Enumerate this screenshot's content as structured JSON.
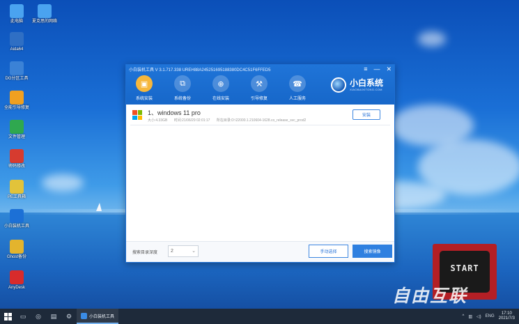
{
  "desktop": {
    "icons": [
      {
        "label": "此电脑",
        "icon": "computer-icon",
        "color": "#4aa3f0"
      },
      {
        "label": "夏克思的网络",
        "icon": "network-icon",
        "color": "#4aa3f0"
      },
      {
        "label": "Aida64",
        "icon": "aida64-icon",
        "color": "#2f6fc4"
      },
      {
        "label": "DG分区工具",
        "icon": "partition-icon",
        "color": "#3b82d6"
      },
      {
        "label": "全能引导修复",
        "icon": "repair-icon",
        "color": "#f0a020"
      },
      {
        "label": "文件管理",
        "icon": "file-manager-icon",
        "color": "#2fa84f"
      },
      {
        "label": "密码修改",
        "icon": "password-icon",
        "color": "#d63b2f"
      },
      {
        "label": "PE工具箱",
        "icon": "toolbox-icon",
        "color": "#e2c33a"
      },
      {
        "label": "小白装机工具",
        "icon": "installer-icon",
        "color": "#1c70d6"
      },
      {
        "label": "Ghost备份",
        "icon": "ghost-icon",
        "color": "#e3b42d"
      },
      {
        "label": "AnyDesk",
        "icon": "anydesk-icon",
        "color": "#d82b2b"
      }
    ]
  },
  "window": {
    "title": "小白装机工具 V 3.1.717.338 UREH88A245251695188380DC4C51F6FFED5",
    "controls": {
      "menu": "≡",
      "minimize": "—",
      "close": "✕"
    },
    "nav": [
      {
        "label": "系统安装",
        "icon": "system-install-icon",
        "glyph": "▣",
        "active": true
      },
      {
        "label": "系统备份",
        "icon": "system-backup-icon",
        "glyph": "⧉",
        "active": false
      },
      {
        "label": "在线安装",
        "icon": "online-install-icon",
        "glyph": "⊕",
        "active": false
      },
      {
        "label": "引导修复",
        "icon": "boot-repair-icon",
        "glyph": "⚒",
        "active": false
      },
      {
        "label": "人工服务",
        "icon": "support-icon",
        "glyph": "☎",
        "active": false
      }
    ],
    "brand": {
      "name": "小白系统",
      "sub": "XIAOBAIXITONG.COM"
    },
    "image_row": {
      "name": "1、windows 11 pro",
      "size": "大小:4.33GB",
      "date": "时间:21/06/29 02:01:17",
      "path": "所在目录:D:\\22000.1.210604-1628.co_release_svc_prod2",
      "install_label": "安装"
    },
    "footer": {
      "depth_label": "搜索目录深度",
      "depth_value": "2",
      "manual_label": "手动选择",
      "search_label": "搜索镜像"
    }
  },
  "badge": {
    "text": "START"
  },
  "watermark": {
    "text": "自由互联"
  },
  "taskbar": {
    "app_label": "小白装机工具",
    "lang": "ENG",
    "time": "17:10",
    "date": "2021/7/3"
  }
}
